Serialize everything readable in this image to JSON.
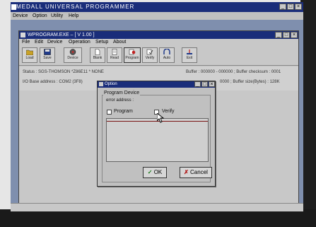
{
  "outer_window": {
    "title": "MEDALL UNIVERSAL PROGRAMMER",
    "menu": [
      "Device",
      "Option",
      "Utility",
      "Help"
    ],
    "controls": [
      "_",
      "□",
      "×"
    ]
  },
  "inner_window": {
    "title": "WPROGRAM.EXE – [ V 1.00 ]",
    "menu": [
      "File",
      "Edit",
      "Device",
      "Operation",
      "Setup",
      "About"
    ],
    "controls": [
      "_",
      "□",
      "×"
    ],
    "toolbar": [
      {
        "label": "Load",
        "icon": "folder-icon"
      },
      {
        "label": "Save",
        "icon": "disk-icon"
      },
      {
        "label": "Device",
        "icon": "chip-icon"
      },
      {
        "label": "Blank",
        "icon": "page-icon"
      },
      {
        "label": "Read",
        "icon": "read-icon"
      },
      {
        "label": "Program",
        "icon": "program-icon"
      },
      {
        "label": "Verify",
        "icon": "verify-icon"
      },
      {
        "label": "Auto",
        "icon": "auto-icon"
      },
      {
        "label": "Exit",
        "icon": "exit-icon"
      }
    ],
    "status": {
      "line1": "Status : SGS-THOMSON *Z86E11 * NONE",
      "line1_right": "Buffer : 000000 - 000000 ; Buffer checksum : 0001",
      "line2": "I/O Base address : COM2 (3F8)",
      "line2_right": "0000 ; Buffer size(Bytes) : 128K"
    }
  },
  "dialog": {
    "title": "Option",
    "controls": [
      "_",
      "□",
      "×"
    ],
    "group_label": "Program Device",
    "error_label": "error address :",
    "checkbox_program": "Program",
    "checkbox_verify": "Verify",
    "ok_label": "OK",
    "cancel_label": "Cancel"
  }
}
